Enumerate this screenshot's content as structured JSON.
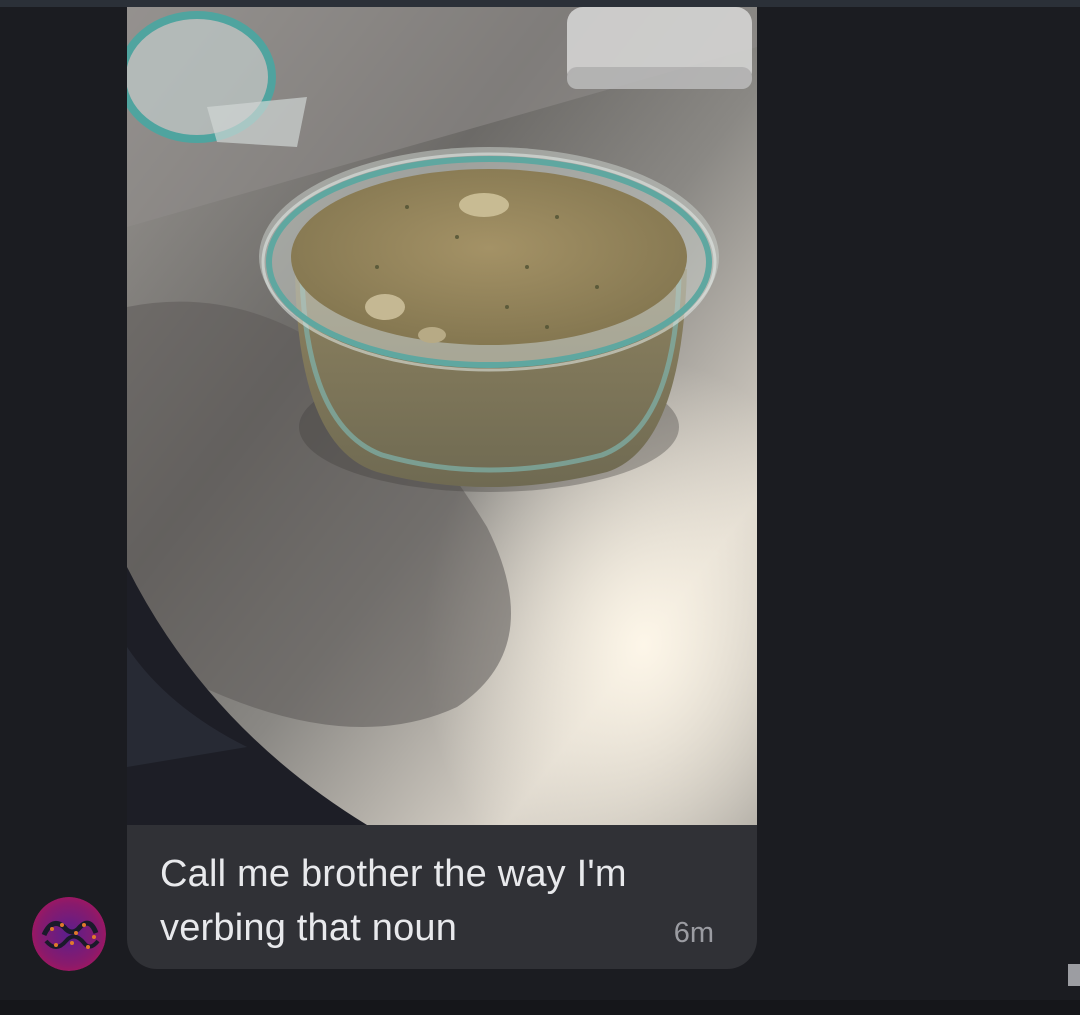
{
  "message": {
    "text": "Call me brother the way I'm verbing that noun",
    "time": "6m",
    "image_alt": "Glass bowl of greenish broth on a stainless steel counter"
  },
  "avatar": {
    "icon": "fractal-avatar"
  },
  "colors": {
    "background": "#1b1c21",
    "bubble": "#303136",
    "text": "#e8e9ec",
    "timestamp": "#9b9ca2"
  }
}
